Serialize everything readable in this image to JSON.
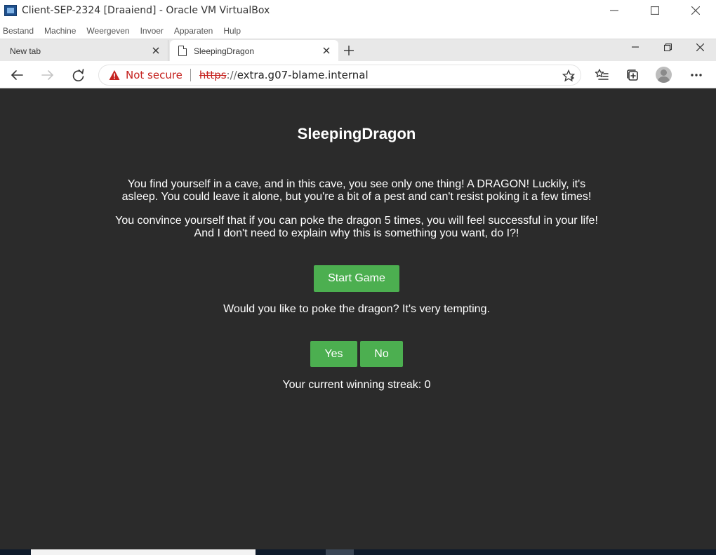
{
  "vm_window": {
    "title": "Client-SEP-2324 [Draaiend] - Oracle VM VirtualBox",
    "menu": [
      "Bestand",
      "Machine",
      "Weergeven",
      "Invoer",
      "Apparaten",
      "Hulp"
    ]
  },
  "browser": {
    "tabs": [
      {
        "label": "New tab",
        "active": false
      },
      {
        "label": "SleepingDragon",
        "active": true
      }
    ],
    "address": {
      "security_label": "Not secure",
      "scheme": "https",
      "scheme_sep": "://",
      "host": "extra.g07-blame.internal"
    }
  },
  "game": {
    "title": "SleepingDragon",
    "intro_1": "You find yourself in a cave, and in this cave, you see only one thing! A DRAGON! Luckily, it's asleep. You could leave it alone, but you're a bit of a pest and can't resist poking it a few times!",
    "intro_2": "You convince yourself that if you can poke the dragon 5 times, you will feel successful in your life! And I don't need to explain why this is something you want, do I?!",
    "start_label": "Start Game",
    "question": "Would you like to poke the dragon? It's very tempting.",
    "yes_label": "Yes",
    "no_label": "No",
    "streak_text": "Your current winning streak: 0"
  },
  "colors": {
    "page_bg": "#2b2b2b",
    "button_green": "#4caf50",
    "warning_red": "#c5221f"
  }
}
